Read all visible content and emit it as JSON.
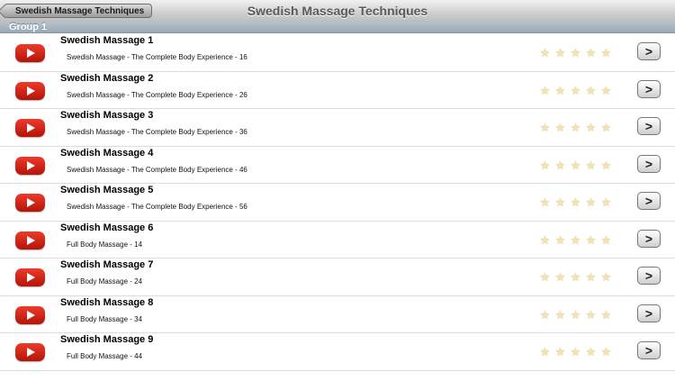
{
  "navbar": {
    "back_label": "Swedish Massage Techniques",
    "title": "Swedish Massage Techniques"
  },
  "section": {
    "header": "Group 1"
  },
  "rating": 0,
  "items": [
    {
      "title": "Swedish Massage 1",
      "subtitle": "Swedish Massage - The Complete Body Experience  - 16"
    },
    {
      "title": "Swedish Massage 2",
      "subtitle": "Swedish Massage - The Complete Body Experience  - 26"
    },
    {
      "title": "Swedish Massage 3",
      "subtitle": "Swedish Massage - The Complete Body Experience  - 36"
    },
    {
      "title": "Swedish Massage 4",
      "subtitle": "Swedish Massage - The Complete Body Experience  - 46"
    },
    {
      "title": "Swedish Massage 5",
      "subtitle": "Swedish Massage - The Complete Body Experience  - 56"
    },
    {
      "title": "Swedish Massage 6",
      "subtitle": "Full Body Massage  - 14"
    },
    {
      "title": "Swedish Massage 7",
      "subtitle": "Full Body Massage  - 24"
    },
    {
      "title": "Swedish Massage 8",
      "subtitle": "Full Body Massage  - 34"
    },
    {
      "title": "Swedish Massage 9",
      "subtitle": "Full Body Massage  - 44"
    }
  ],
  "icons": {
    "play": "play-video-icon",
    "star": "star-icon",
    "chevron": "chevron-right-icon",
    "back": "back-arrow-icon"
  },
  "colors": {
    "play_red": "#d9231a",
    "section_header": "#a8b5bf",
    "star_empty": "#f3e3b0"
  }
}
